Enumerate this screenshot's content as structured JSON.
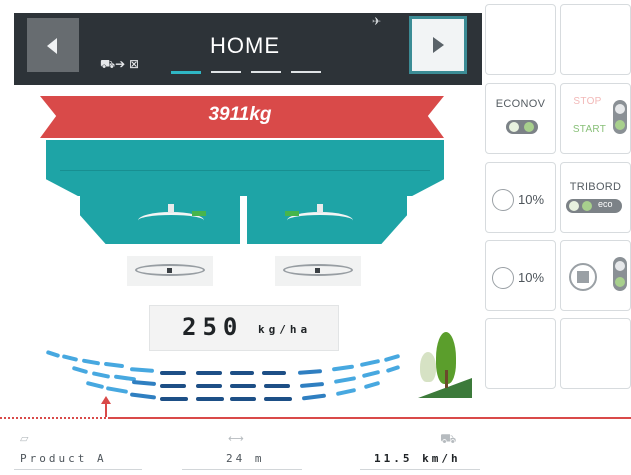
{
  "header": {
    "title": "HOME",
    "prev_icon": "chevron-left-icon",
    "next_icon": "chevron-right-icon",
    "tractor_icon": "tractor-link-icon",
    "gps_icon": "satellite-icon",
    "pages": 4,
    "active_page": 1
  },
  "machine": {
    "weight": "3911kg",
    "rate_value": "250",
    "rate_unit": "kg/ha"
  },
  "grid": {
    "econov_label": "ECONOV",
    "econov_on": true,
    "stop_label": "STOP",
    "start_label": "START",
    "tribord_label": "TRIBORD",
    "eco_label": "eco",
    "left_pct": "10%",
    "right_pct": "10%"
  },
  "status_bar": {
    "product": "Product A",
    "width": "24 m",
    "speed": "11.5 km/h"
  },
  "colors": {
    "header_bg": "#2d3338",
    "accent": "#2fb6c4",
    "hopper_red": "#d94a49",
    "hopper_teal": "#1ea4a6",
    "toggle_green": "#a8d08d"
  }
}
